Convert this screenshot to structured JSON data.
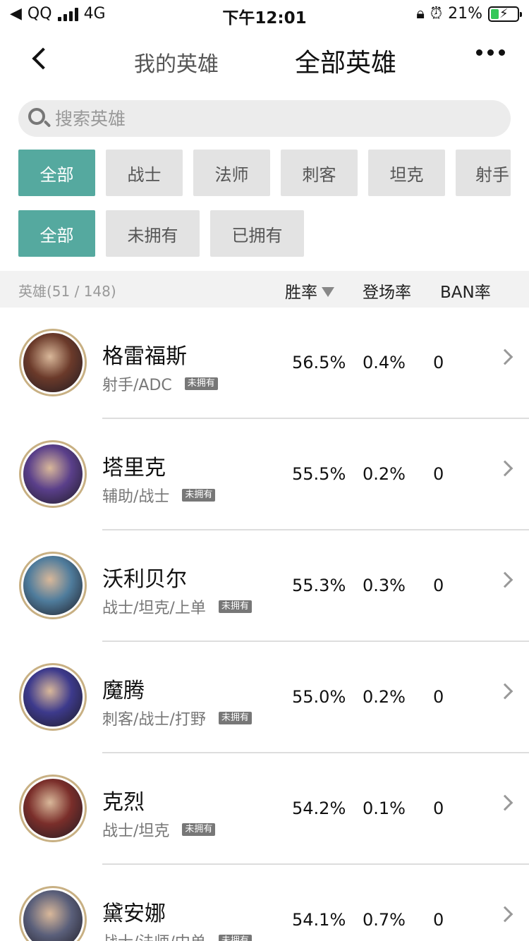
{
  "status_bar": {
    "carrier": "QQ",
    "network": "4G",
    "time": "下午12:01",
    "battery": "21%"
  },
  "nav": {
    "tab_mine": "我的英雄",
    "tab_all": "全部英雄"
  },
  "search": {
    "placeholder": "搜索英雄"
  },
  "role_filters": [
    "全部",
    "战士",
    "法师",
    "刺客",
    "坦克",
    "射手"
  ],
  "own_filters": [
    "全部",
    "未拥有",
    "已拥有"
  ],
  "table_header": {
    "count": "英雄(51 / 148)",
    "win_rate": "胜率",
    "appear_rate": "登场率",
    "ban_rate": "BAN率"
  },
  "heroes": [
    {
      "name": "格雷福斯",
      "role": "射手/ADC",
      "tag": "未拥有",
      "win": "56.5%",
      "appear": "0.4%",
      "ban": "0",
      "color": "#6b3a2a"
    },
    {
      "name": "塔里克",
      "role": "辅助/战士",
      "tag": "未拥有",
      "win": "55.5%",
      "appear": "0.2%",
      "ban": "0",
      "color": "#5a3f8a"
    },
    {
      "name": "沃利贝尔",
      "role": "战士/坦克/上单",
      "tag": "未拥有",
      "win": "55.3%",
      "appear": "0.3%",
      "ban": "0",
      "color": "#4f7c9c"
    },
    {
      "name": "魔腾",
      "role": "刺客/战士/打野",
      "tag": "未拥有",
      "win": "55.0%",
      "appear": "0.2%",
      "ban": "0",
      "color": "#3d3a8c"
    },
    {
      "name": "克烈",
      "role": "战士/坦克",
      "tag": "未拥有",
      "win": "54.2%",
      "appear": "0.1%",
      "ban": "0",
      "color": "#7a2e2a"
    },
    {
      "name": "黛安娜",
      "role": "战士/法师/中单",
      "tag": "未拥有",
      "win": "54.1%",
      "appear": "0.7%",
      "ban": "0",
      "color": "#5a5f7a"
    }
  ]
}
